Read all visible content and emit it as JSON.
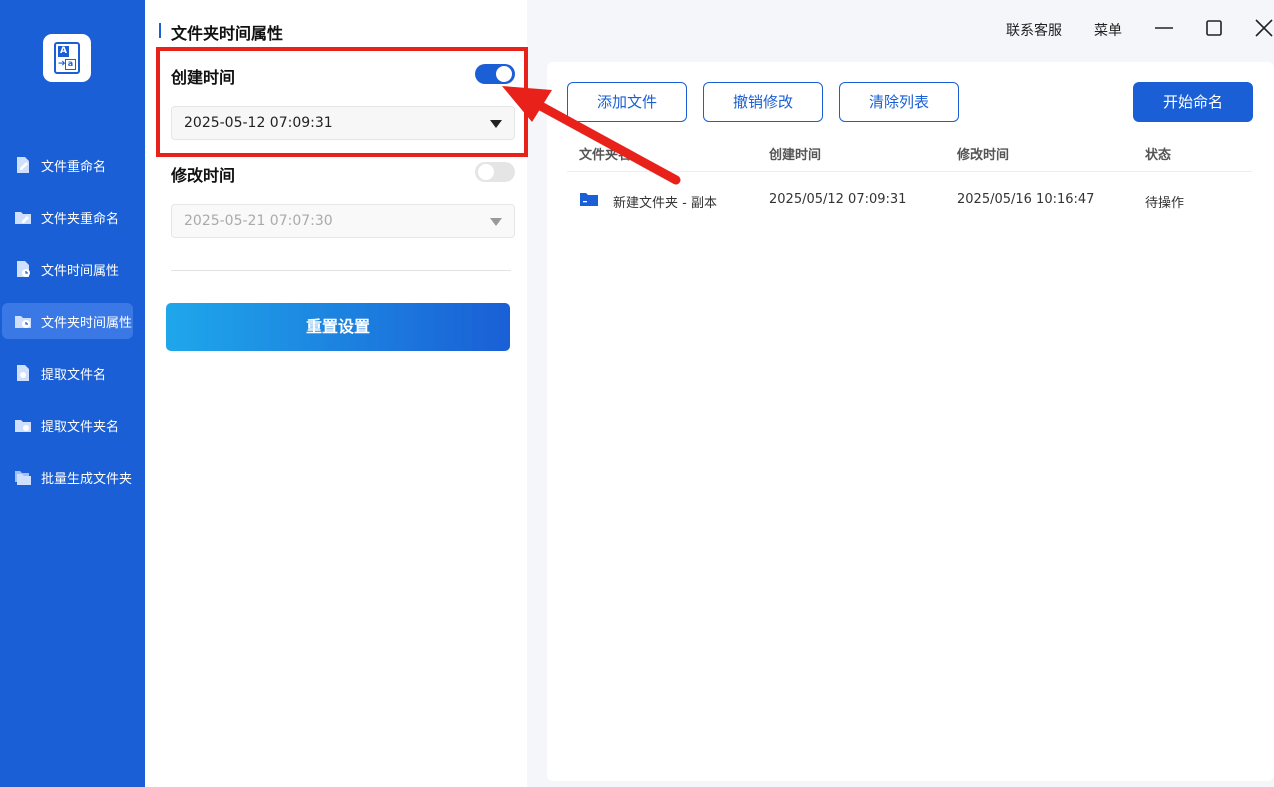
{
  "sidebar": {
    "items": [
      {
        "label": "文件重命名",
        "icon": "file-edit-icon"
      },
      {
        "label": "文件夹重命名",
        "icon": "folder-edit-icon"
      },
      {
        "label": "文件时间属性",
        "icon": "file-clock-icon"
      },
      {
        "label": "文件夹时间属性",
        "icon": "folder-clock-icon",
        "active": true
      },
      {
        "label": "提取文件名",
        "icon": "file-extract-icon"
      },
      {
        "label": "提取文件夹名",
        "icon": "folder-extract-icon"
      },
      {
        "label": "批量生成文件夹",
        "icon": "folder-batch-icon"
      }
    ]
  },
  "panel": {
    "title": "文件夹时间属性",
    "create_time": {
      "label": "创建时间",
      "enabled": true,
      "value": "2025-05-12 07:09:31"
    },
    "modify_time": {
      "label": "修改时间",
      "enabled": false,
      "value": "2025-05-21 07:07:30"
    },
    "reset_label": "重置设置"
  },
  "topbar": {
    "support": "联系客服",
    "menu": "菜单"
  },
  "toolbar": {
    "add_files": "添加文件",
    "undo": "撤销修改",
    "clear": "清除列表",
    "start": "开始命名"
  },
  "table": {
    "headers": [
      "文件夹名",
      "创建时间",
      "修改时间",
      "状态"
    ],
    "rows": [
      {
        "name": "新建文件夹 - 副本",
        "created": "2025/05/12 07:09:31",
        "modified": "2025/05/16 10:16:47",
        "status": "待操作"
      }
    ]
  },
  "colors": {
    "sidebar_bg": "#1a5fd6",
    "accent": "#1a5fd6",
    "highlight": "#e8221b"
  }
}
